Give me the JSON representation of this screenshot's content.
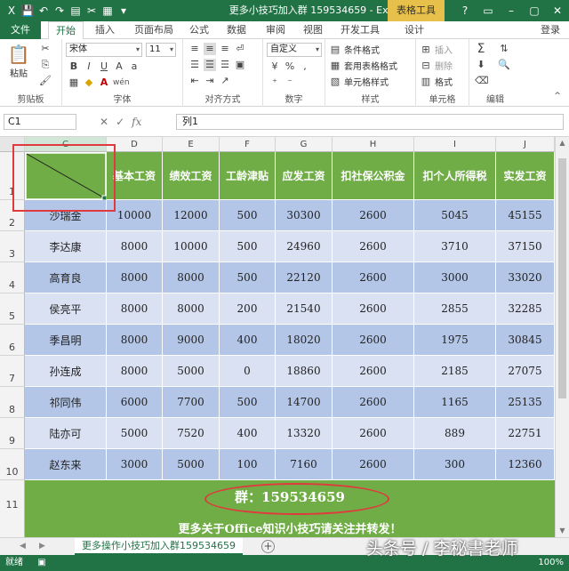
{
  "window": {
    "title": "更多小技巧加入群 159534659 - Excel",
    "context_tab": "表格工具",
    "controls": [
      "?",
      "▭",
      "–",
      "▢",
      "✕"
    ]
  },
  "quick_access": [
    "X",
    "💾",
    "↶",
    "↷",
    "▤",
    "✂",
    "▦",
    "▾"
  ],
  "tabs": [
    "文件",
    "开始",
    "插入",
    "页面布局",
    "公式",
    "数据",
    "审阅",
    "视图",
    "开发工具",
    "设计"
  ],
  "login": "登录",
  "ribbon": {
    "clipboard": {
      "paste": "粘贴",
      "label": "剪贴板"
    },
    "font": {
      "name": "宋体",
      "size": "11",
      "label": "字体",
      "wen": "wén"
    },
    "alignment": {
      "label": "对齐方式"
    },
    "number": {
      "format": "自定义",
      "label": "数字",
      "percent": "%",
      "comma": ","
    },
    "styles": {
      "cond_format": "条件格式",
      "table_format": "套用表格格式",
      "cell_styles": "单元格样式",
      "label": "样式"
    },
    "cells": {
      "insert": "插入",
      "delete": "删除",
      "format": "格式",
      "label": "单元格"
    },
    "editing": {
      "label": "编辑"
    }
  },
  "formula_bar": {
    "name_box": "C1",
    "content": "列1",
    "fx": "fx"
  },
  "columns": [
    "C",
    "D",
    "E",
    "F",
    "G",
    "H",
    "I",
    "J"
  ],
  "rows": [
    "1",
    "2",
    "3",
    "4",
    "5",
    "6",
    "7",
    "8",
    "9",
    "10",
    "11"
  ],
  "table": {
    "headers": [
      "",
      "基本工资",
      "绩效工资",
      "工龄津贴",
      "应发工资",
      "扣社保公积金",
      "扣个人所得税",
      "实发工资"
    ],
    "data": [
      [
        "沙瑞金",
        "10000",
        "12000",
        "500",
        "30300",
        "2600",
        "5045",
        "45155"
      ],
      [
        "李达康",
        "8000",
        "10000",
        "500",
        "24960",
        "2600",
        "3710",
        "37150"
      ],
      [
        "高育良",
        "8000",
        "8000",
        "500",
        "22120",
        "2600",
        "3000",
        "33020"
      ],
      [
        "侯亮平",
        "8000",
        "8000",
        "200",
        "21540",
        "2600",
        "2855",
        "32285"
      ],
      [
        "季昌明",
        "8000",
        "9000",
        "400",
        "18020",
        "2600",
        "1975",
        "30845"
      ],
      [
        "孙连成",
        "8000",
        "5000",
        "0",
        "18860",
        "2600",
        "2185",
        "27075"
      ],
      [
        "祁同伟",
        "6000",
        "7700",
        "500",
        "14700",
        "2600",
        "1165",
        "25135"
      ],
      [
        "陆亦可",
        "5000",
        "7520",
        "400",
        "13320",
        "2600",
        "889",
        "22751"
      ],
      [
        "赵东来",
        "3000",
        "5000",
        "100",
        "7160",
        "2600",
        "300",
        "12360"
      ]
    ]
  },
  "footer": {
    "group_text": "群：159534659",
    "more_text": "更多关于Office知识小技巧请关注并转发！"
  },
  "sheet_tab": "更多操作小技巧加入群159534659",
  "status": {
    "ready": "就绪",
    "zoom": "100%"
  },
  "watermark": "头条号 / 李秘書老师",
  "colors": {
    "excel_green": "#217346",
    "header_green": "#70ad47",
    "row_dark": "#b4c6e7",
    "row_light": "#d9e1f2",
    "annotation_red": "#e0393e"
  }
}
